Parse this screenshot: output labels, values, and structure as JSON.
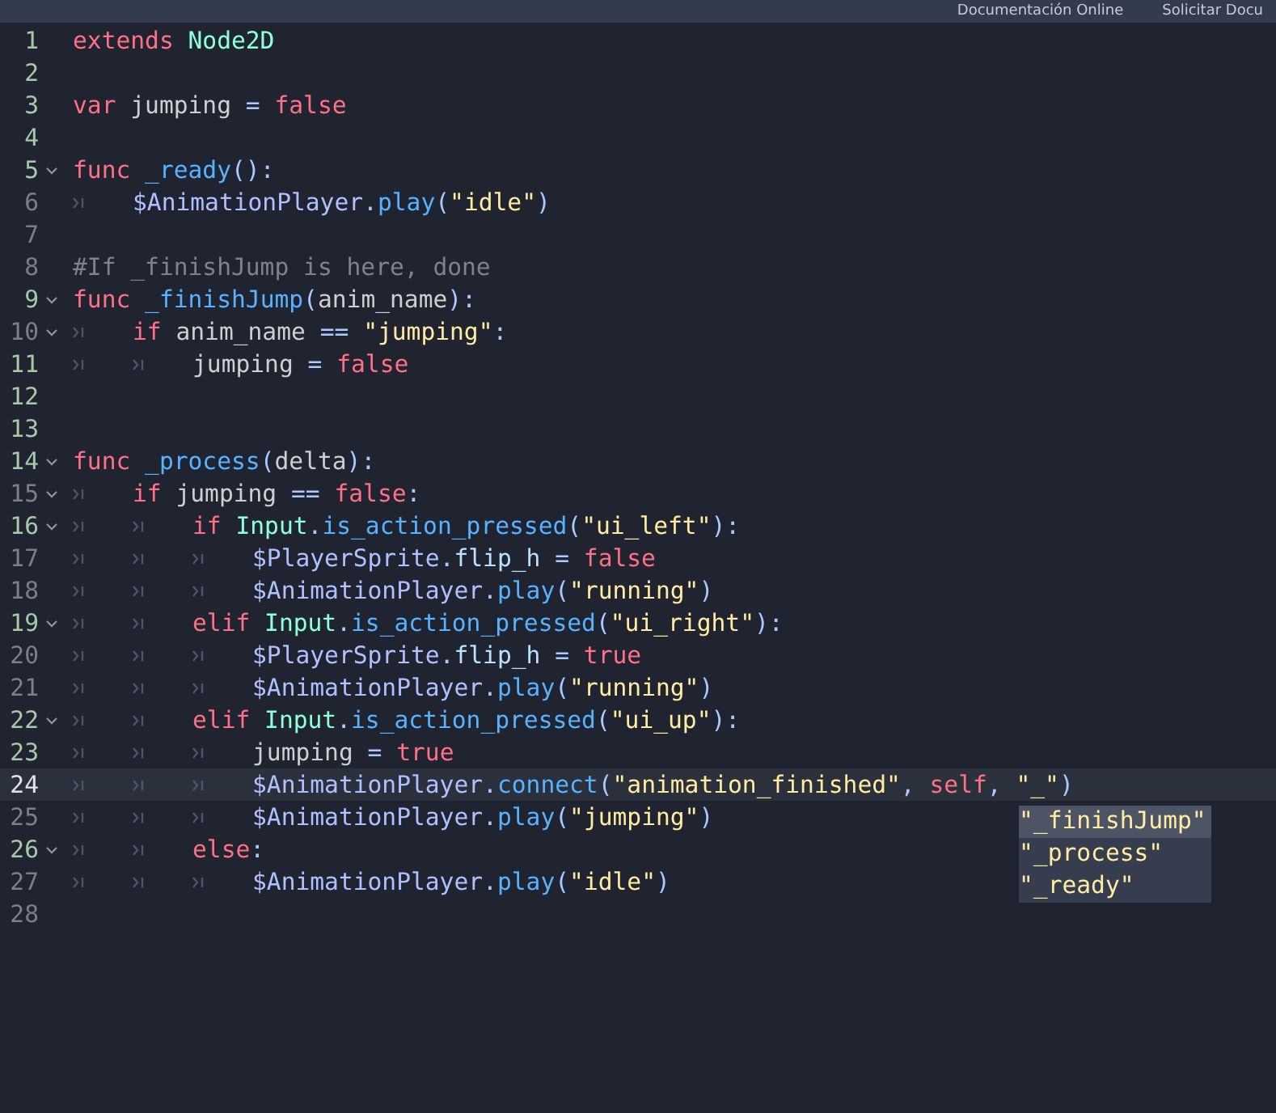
{
  "top_bar": {
    "links": [
      {
        "label": "Documentación Online"
      },
      {
        "label": "Solicitar Docu"
      }
    ]
  },
  "editor": {
    "lines": [
      {
        "number": "1",
        "modified": true,
        "foldable": false,
        "current": false,
        "tokens": [
          {
            "kind": "keyword",
            "text": "extends"
          },
          {
            "kind": "space"
          },
          {
            "kind": "type",
            "text": "Node2D"
          }
        ]
      },
      {
        "number": "2",
        "modified": true,
        "foldable": false,
        "current": false
      },
      {
        "number": "3",
        "modified": true,
        "foldable": false,
        "current": false,
        "tokens": [
          {
            "kind": "keyword",
            "text": "var"
          },
          {
            "kind": "space"
          },
          {
            "kind": "plain",
            "text": "jumping"
          },
          {
            "kind": "space"
          },
          {
            "kind": "symbol",
            "text": "="
          },
          {
            "kind": "space"
          },
          {
            "kind": "keyword",
            "text": "false"
          }
        ]
      },
      {
        "number": "4",
        "modified": true,
        "foldable": false,
        "current": false
      },
      {
        "number": "5",
        "modified": true,
        "foldable": true,
        "current": false,
        "tokens": [
          {
            "kind": "keyword",
            "text": "func"
          },
          {
            "kind": "space"
          },
          {
            "kind": "function",
            "text": "_ready"
          },
          {
            "kind": "symbol",
            "text": "():"
          }
        ]
      },
      {
        "number": "6",
        "modified": false,
        "foldable": false,
        "current": false,
        "tokens": [
          {
            "kind": "tab"
          },
          {
            "kind": "node",
            "text": "$AnimationPlayer"
          },
          {
            "kind": "symbol",
            "text": "."
          },
          {
            "kind": "function",
            "text": "play"
          },
          {
            "kind": "symbol",
            "text": "("
          },
          {
            "kind": "string",
            "text": "\"idle\""
          },
          {
            "kind": "symbol",
            "text": ")"
          }
        ]
      },
      {
        "number": "7",
        "modified": false,
        "foldable": false,
        "current": false
      },
      {
        "number": "8",
        "modified": false,
        "foldable": false,
        "current": false,
        "tokens": [
          {
            "kind": "comment",
            "text": "#If _finishJump is here, done"
          }
        ]
      },
      {
        "number": "9",
        "modified": true,
        "foldable": true,
        "current": false,
        "tokens": [
          {
            "kind": "keyword",
            "text": "func"
          },
          {
            "kind": "space"
          },
          {
            "kind": "function",
            "text": "_finishJump"
          },
          {
            "kind": "symbol",
            "text": "("
          },
          {
            "kind": "plain",
            "text": "anim_name"
          },
          {
            "kind": "symbol",
            "text": "):"
          }
        ]
      },
      {
        "number": "10",
        "modified": false,
        "foldable": true,
        "current": false,
        "tokens": [
          {
            "kind": "tab"
          },
          {
            "kind": "keyword",
            "text": "if"
          },
          {
            "kind": "space"
          },
          {
            "kind": "plain",
            "text": "anim_name"
          },
          {
            "kind": "space"
          },
          {
            "kind": "symbol",
            "text": "=="
          },
          {
            "kind": "space"
          },
          {
            "kind": "string",
            "text": "\"jumping\""
          },
          {
            "kind": "symbol",
            "text": ":"
          }
        ]
      },
      {
        "number": "11",
        "modified": true,
        "foldable": false,
        "current": false,
        "tokens": [
          {
            "kind": "tab"
          },
          {
            "kind": "tab"
          },
          {
            "kind": "plain",
            "text": "jumping"
          },
          {
            "kind": "space"
          },
          {
            "kind": "symbol",
            "text": "="
          },
          {
            "kind": "space"
          },
          {
            "kind": "keyword",
            "text": "false"
          }
        ]
      },
      {
        "number": "12",
        "modified": true,
        "foldable": false,
        "current": false
      },
      {
        "number": "13",
        "modified": true,
        "foldable": false,
        "current": false
      },
      {
        "number": "14",
        "modified": true,
        "foldable": true,
        "current": false,
        "tokens": [
          {
            "kind": "keyword",
            "text": "func"
          },
          {
            "kind": "space"
          },
          {
            "kind": "function",
            "text": "_process"
          },
          {
            "kind": "symbol",
            "text": "("
          },
          {
            "kind": "plain",
            "text": "delta"
          },
          {
            "kind": "symbol",
            "text": "):"
          }
        ]
      },
      {
        "number": "15",
        "modified": false,
        "foldable": true,
        "current": false,
        "tokens": [
          {
            "kind": "tab"
          },
          {
            "kind": "keyword",
            "text": "if"
          },
          {
            "kind": "space"
          },
          {
            "kind": "plain",
            "text": "jumping"
          },
          {
            "kind": "space"
          },
          {
            "kind": "symbol",
            "text": "=="
          },
          {
            "kind": "space"
          },
          {
            "kind": "keyword",
            "text": "false"
          },
          {
            "kind": "symbol",
            "text": ":"
          }
        ]
      },
      {
        "number": "16",
        "modified": true,
        "foldable": true,
        "current": false,
        "tokens": [
          {
            "kind": "tab"
          },
          {
            "kind": "tab"
          },
          {
            "kind": "keyword",
            "text": "if"
          },
          {
            "kind": "space"
          },
          {
            "kind": "type",
            "text": "Input"
          },
          {
            "kind": "symbol",
            "text": "."
          },
          {
            "kind": "function",
            "text": "is_action_pressed"
          },
          {
            "kind": "symbol",
            "text": "("
          },
          {
            "kind": "string",
            "text": "\"ui_left\""
          },
          {
            "kind": "symbol",
            "text": "):"
          }
        ]
      },
      {
        "number": "17",
        "modified": false,
        "foldable": false,
        "current": false,
        "tokens": [
          {
            "kind": "tab"
          },
          {
            "kind": "tab"
          },
          {
            "kind": "tab"
          },
          {
            "kind": "node",
            "text": "$PlayerSprite"
          },
          {
            "kind": "symbol",
            "text": "."
          },
          {
            "kind": "member",
            "text": "flip_h"
          },
          {
            "kind": "space"
          },
          {
            "kind": "symbol",
            "text": "="
          },
          {
            "kind": "space"
          },
          {
            "kind": "keyword",
            "text": "false"
          }
        ]
      },
      {
        "number": "18",
        "modified": false,
        "foldable": false,
        "current": false,
        "tokens": [
          {
            "kind": "tab"
          },
          {
            "kind": "tab"
          },
          {
            "kind": "tab"
          },
          {
            "kind": "node",
            "text": "$AnimationPlayer"
          },
          {
            "kind": "symbol",
            "text": "."
          },
          {
            "kind": "function",
            "text": "play"
          },
          {
            "kind": "symbol",
            "text": "("
          },
          {
            "kind": "string",
            "text": "\"running\""
          },
          {
            "kind": "symbol",
            "text": ")"
          }
        ]
      },
      {
        "number": "19",
        "modified": true,
        "foldable": true,
        "current": false,
        "tokens": [
          {
            "kind": "tab"
          },
          {
            "kind": "tab"
          },
          {
            "kind": "keyword",
            "text": "elif"
          },
          {
            "kind": "space"
          },
          {
            "kind": "type",
            "text": "Input"
          },
          {
            "kind": "symbol",
            "text": "."
          },
          {
            "kind": "function",
            "text": "is_action_pressed"
          },
          {
            "kind": "symbol",
            "text": "("
          },
          {
            "kind": "string",
            "text": "\"ui_right\""
          },
          {
            "kind": "symbol",
            "text": "):"
          }
        ]
      },
      {
        "number": "20",
        "modified": false,
        "foldable": false,
        "current": false,
        "tokens": [
          {
            "kind": "tab"
          },
          {
            "kind": "tab"
          },
          {
            "kind": "tab"
          },
          {
            "kind": "node",
            "text": "$PlayerSprite"
          },
          {
            "kind": "symbol",
            "text": "."
          },
          {
            "kind": "member",
            "text": "flip_h"
          },
          {
            "kind": "space"
          },
          {
            "kind": "symbol",
            "text": "="
          },
          {
            "kind": "space"
          },
          {
            "kind": "keyword",
            "text": "true"
          }
        ]
      },
      {
        "number": "21",
        "modified": false,
        "foldable": false,
        "current": false,
        "tokens": [
          {
            "kind": "tab"
          },
          {
            "kind": "tab"
          },
          {
            "kind": "tab"
          },
          {
            "kind": "node",
            "text": "$AnimationPlayer"
          },
          {
            "kind": "symbol",
            "text": "."
          },
          {
            "kind": "function",
            "text": "play"
          },
          {
            "kind": "symbol",
            "text": "("
          },
          {
            "kind": "string",
            "text": "\"running\""
          },
          {
            "kind": "symbol",
            "text": ")"
          }
        ]
      },
      {
        "number": "22",
        "modified": true,
        "foldable": true,
        "current": false,
        "tokens": [
          {
            "kind": "tab"
          },
          {
            "kind": "tab"
          },
          {
            "kind": "keyword",
            "text": "elif"
          },
          {
            "kind": "space"
          },
          {
            "kind": "type",
            "text": "Input"
          },
          {
            "kind": "symbol",
            "text": "."
          },
          {
            "kind": "function",
            "text": "is_action_pressed"
          },
          {
            "kind": "symbol",
            "text": "("
          },
          {
            "kind": "string",
            "text": "\"ui_up\""
          },
          {
            "kind": "symbol",
            "text": "):"
          }
        ]
      },
      {
        "number": "23",
        "modified": true,
        "foldable": false,
        "current": false,
        "tokens": [
          {
            "kind": "tab"
          },
          {
            "kind": "tab"
          },
          {
            "kind": "tab"
          },
          {
            "kind": "plain",
            "text": "jumping"
          },
          {
            "kind": "space"
          },
          {
            "kind": "symbol",
            "text": "="
          },
          {
            "kind": "space"
          },
          {
            "kind": "keyword",
            "text": "true"
          }
        ]
      },
      {
        "number": "24",
        "modified": true,
        "foldable": false,
        "current": true,
        "tokens": [
          {
            "kind": "tab"
          },
          {
            "kind": "tab"
          },
          {
            "kind": "tab"
          },
          {
            "kind": "node",
            "text": "$AnimationPlayer"
          },
          {
            "kind": "symbol",
            "text": "."
          },
          {
            "kind": "function",
            "text": "connect"
          },
          {
            "kind": "symbol",
            "text": "("
          },
          {
            "kind": "string",
            "text": "\"animation_finished\""
          },
          {
            "kind": "symbol",
            "text": ","
          },
          {
            "kind": "space"
          },
          {
            "kind": "keyword",
            "text": "self"
          },
          {
            "kind": "symbol",
            "text": ","
          },
          {
            "kind": "space"
          },
          {
            "kind": "string",
            "text": "\"_\""
          },
          {
            "kind": "symbol",
            "text": ")"
          }
        ]
      },
      {
        "number": "25",
        "modified": false,
        "foldable": false,
        "current": false,
        "tokens": [
          {
            "kind": "tab"
          },
          {
            "kind": "tab"
          },
          {
            "kind": "tab"
          },
          {
            "kind": "node",
            "text": "$AnimationPlayer"
          },
          {
            "kind": "symbol",
            "text": "."
          },
          {
            "kind": "function",
            "text": "play"
          },
          {
            "kind": "symbol",
            "text": "("
          },
          {
            "kind": "string",
            "text": "\"jumping\""
          },
          {
            "kind": "symbol",
            "text": ")"
          }
        ]
      },
      {
        "number": "26",
        "modified": true,
        "foldable": true,
        "current": false,
        "tokens": [
          {
            "kind": "tab"
          },
          {
            "kind": "tab"
          },
          {
            "kind": "keyword",
            "text": "else"
          },
          {
            "kind": "symbol",
            "text": ":"
          }
        ]
      },
      {
        "number": "27",
        "modified": false,
        "foldable": false,
        "current": false,
        "tokens": [
          {
            "kind": "tab"
          },
          {
            "kind": "tab"
          },
          {
            "kind": "tab"
          },
          {
            "kind": "node",
            "text": "$AnimationPlayer"
          },
          {
            "kind": "symbol",
            "text": "."
          },
          {
            "kind": "function",
            "text": "play"
          },
          {
            "kind": "symbol",
            "text": "("
          },
          {
            "kind": "string",
            "text": "\"idle\""
          },
          {
            "kind": "symbol",
            "text": ")"
          }
        ]
      },
      {
        "number": "28",
        "modified": false,
        "foldable": false,
        "current": false
      }
    ]
  },
  "autocomplete": {
    "items": [
      {
        "label": "\"_finishJump\"",
        "selected": true
      },
      {
        "label": "\"_process\"",
        "selected": false
      },
      {
        "label": "\"_ready\"",
        "selected": false
      }
    ]
  }
}
